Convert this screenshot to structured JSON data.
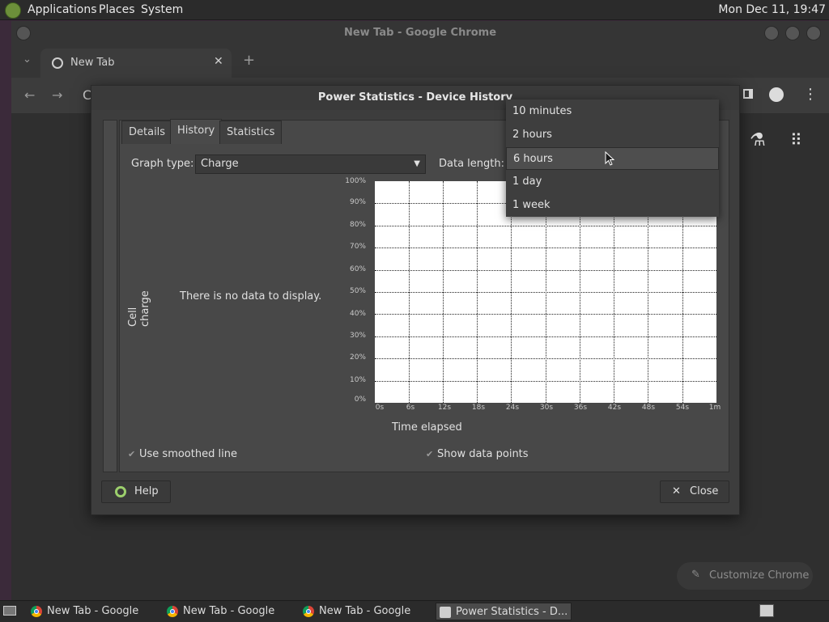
{
  "panel": {
    "menus": [
      "Applications",
      "Places",
      "System"
    ],
    "clock": "Mon Dec 11, 19:47"
  },
  "chrome": {
    "window_title": "New Tab - Google Chrome",
    "tab_title": "New Tab",
    "omnibox_letter": "C",
    "customize_label": "Customize Chrome"
  },
  "dialog": {
    "title": "Power Statistics - Device History",
    "tabs": [
      "Details",
      "History",
      "Statistics"
    ],
    "active_tab": "History",
    "graph_type_label": "Graph type:",
    "graph_type_value": "Charge",
    "data_length_label": "Data length:",
    "y_axis_label": "Cell charge",
    "x_axis_label": "Time elapsed",
    "no_data_text": "There is no data to display.",
    "y_ticks": [
      "100%",
      "90%",
      "80%",
      "70%",
      "60%",
      "50%",
      "40%",
      "30%",
      "20%",
      "10%",
      "0%"
    ],
    "x_ticks": [
      "0s",
      "6s",
      "12s",
      "18s",
      "24s",
      "30s",
      "36s",
      "42s",
      "48s",
      "54s",
      "1m"
    ],
    "use_smoothed_line": "Use smoothed line",
    "show_data_points": "Show data points",
    "help_button": "Help",
    "close_button": "Close"
  },
  "dropdown": {
    "options": [
      "10 minutes",
      "2 hours",
      "6 hours",
      "1 day",
      "1 week"
    ],
    "selected": "6 hours"
  },
  "taskbar": {
    "items": [
      "New Tab - Google ...",
      "New Tab - Google ...",
      "New Tab - Google ...",
      "Power Statistics - D..."
    ]
  }
}
